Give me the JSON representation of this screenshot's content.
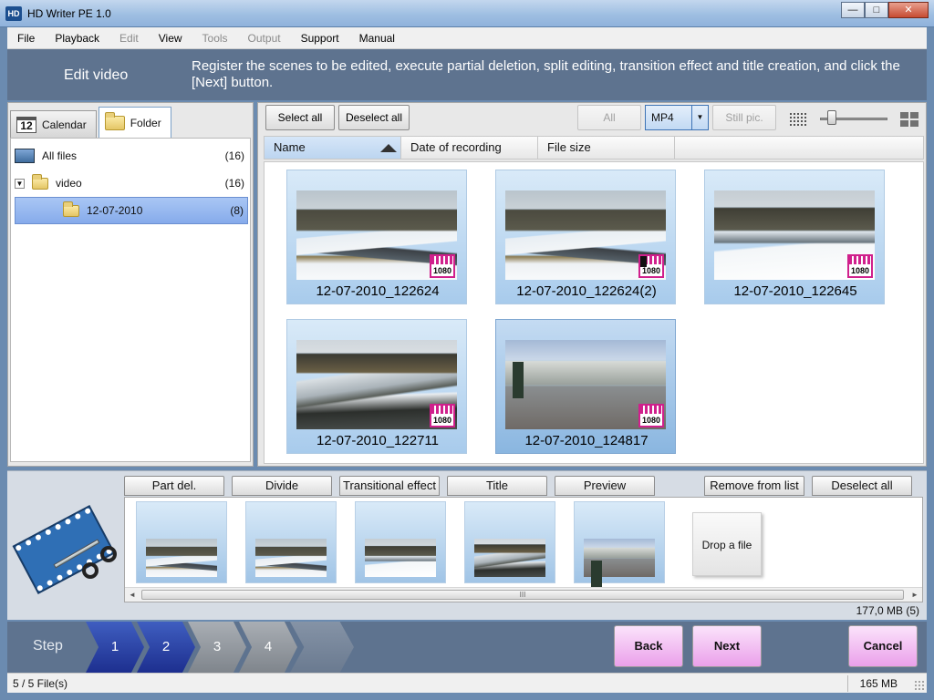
{
  "window": {
    "title": "HD Writer PE 1.0",
    "app_icon_text": "HD",
    "min_glyph": "—",
    "max_glyph": "□",
    "close_glyph": "✕"
  },
  "menu": {
    "items": [
      {
        "label": "File",
        "enabled": true
      },
      {
        "label": "Playback",
        "enabled": true
      },
      {
        "label": "Edit",
        "enabled": false
      },
      {
        "label": "View",
        "enabled": true
      },
      {
        "label": "Tools",
        "enabled": false
      },
      {
        "label": "Output",
        "enabled": false
      },
      {
        "label": "Support",
        "enabled": true
      },
      {
        "label": "Manual",
        "enabled": true
      }
    ]
  },
  "header": {
    "title": "Edit video",
    "description": "Register the scenes to be edited, execute partial deletion, split editing, transition effect and title creation, and click the [Next] button."
  },
  "left_panel": {
    "tabs": [
      {
        "label": "Calendar",
        "icon": "calendar-icon",
        "icon_text": "12",
        "active": false
      },
      {
        "label": "Folder",
        "icon": "folder-icon",
        "active": true
      }
    ],
    "tree": [
      {
        "label": "All files",
        "count": "(16)",
        "icon": "all-files-icon"
      },
      {
        "label": "video",
        "count": "(16)",
        "icon": "folder-icon",
        "expander": "▼"
      },
      {
        "label": "12-07-2010",
        "count": "(8)",
        "icon": "folder-icon",
        "selected": true
      }
    ]
  },
  "toolbar": {
    "select_all": "Select all",
    "deselect_all": "Deselect all",
    "all": "All",
    "format_value": "MP4",
    "format_arrow": "▼",
    "still_pic": "Still pic.",
    "thumbnail_size_level": 0.18
  },
  "columns": [
    "Name",
    "Date of recording",
    "File size"
  ],
  "files": [
    {
      "name": "12-07-2010_122624",
      "badge": "1080",
      "scene": "river"
    },
    {
      "name": "12-07-2010_122624(2)",
      "badge": "1080",
      "scene": "river",
      "mark": true
    },
    {
      "name": "12-07-2010_122645",
      "badge": "1080",
      "scene": "bank"
    },
    {
      "name": "12-07-2010_122711",
      "badge": "1080",
      "scene": "wall"
    },
    {
      "name": "12-07-2010_124817",
      "badge": "1080",
      "scene": "street",
      "selected": true
    }
  ],
  "edit": {
    "buttons": [
      "Part del.",
      "Divide",
      "Transitional effect",
      "Title",
      "Preview"
    ],
    "remove_from_list": "Remove from list",
    "deselect_all": "Deselect all",
    "drop_label": "Drop a file",
    "scroll_left": "◄",
    "scroll_right": "►",
    "scroll_grip": "III",
    "size_info": "177,0 MB (5)"
  },
  "steps": {
    "label": "Step",
    "items": [
      {
        "label": "1",
        "state": "done"
      },
      {
        "label": "2",
        "state": "done"
      },
      {
        "label": "3",
        "state": "todo"
      },
      {
        "label": "4",
        "state": "todo"
      }
    ],
    "back": "Back",
    "next": "Next",
    "cancel": "Cancel"
  },
  "status": {
    "files": "5 / 5 File(s)",
    "free_space": "165 MB"
  },
  "colors": {
    "header_band": "#5e738f",
    "accent_pink": "#eaa0ea",
    "badge": "#d0208c",
    "step_done": "#1d2f8f"
  }
}
